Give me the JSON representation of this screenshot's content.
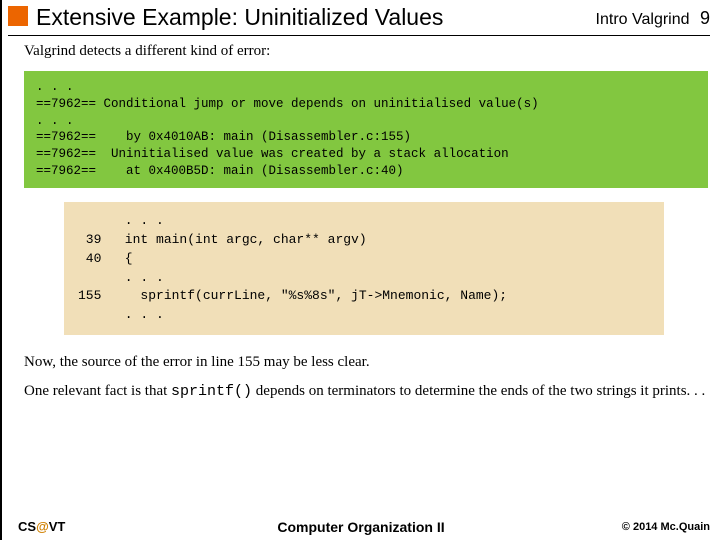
{
  "header": {
    "title": "Extensive Example:  Uninitialized Values",
    "course": "Intro Valgrind",
    "page": "9"
  },
  "intro": "Valgrind detects a different kind of error:",
  "valgrind_output": ". . .\n==7962== Conditional jump or move depends on uninitialised value(s)\n. . .\n==7962==    by 0x4010AB: main (Disassembler.c:155)\n==7962==  Uninitialised value was created by a stack allocation\n==7962==    at 0x400B5D: main (Disassembler.c:40)",
  "code_block": "      . . .\n 39   int main(int argc, char** argv)\n 40   {\n      . . .\n155     sprintf(currLine, \"%s%8s\", jT->Mnemonic, Name);\n      . . .",
  "para2": "Now, the source of the error in line 155 may be less clear.",
  "para3a": "One relevant fact is that ",
  "para3_code": "sprintf()",
  "para3b": " depends on terminators to determine the ends of the two strings it prints. . .",
  "footer": {
    "left_cs": "CS",
    "left_at": "@",
    "left_vt": "VT",
    "center": "Computer Organization II",
    "right": "© 2014 Mc.Quain"
  }
}
